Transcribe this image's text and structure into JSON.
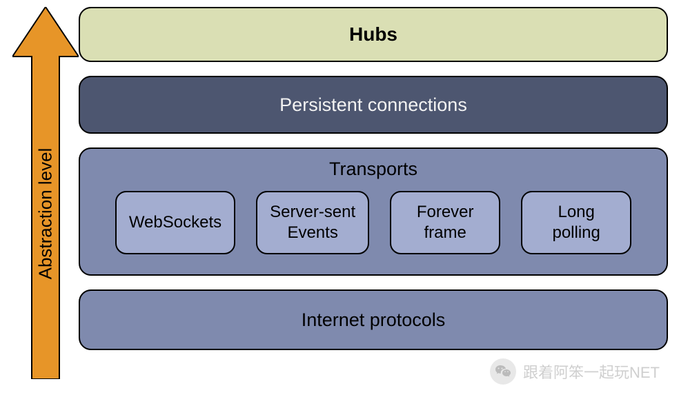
{
  "arrow": {
    "label": "Abstraction level",
    "color": "#e79528"
  },
  "layers": {
    "hubs": {
      "label": "Hubs",
      "bg": "#dadfb4"
    },
    "persistent": {
      "label": "Persistent connections",
      "bg": "#4d5670"
    },
    "transports": {
      "label": "Transports",
      "bg": "#7f8aae",
      "items": [
        "WebSockets",
        "Server-sent\nEvents",
        "Forever\nframe",
        "Long\npolling"
      ]
    },
    "internet": {
      "label": "Internet protocols",
      "bg": "#7f8aae"
    }
  },
  "watermark": {
    "text": "跟着阿笨一起玩NET",
    "icon": "wechat-icon"
  }
}
